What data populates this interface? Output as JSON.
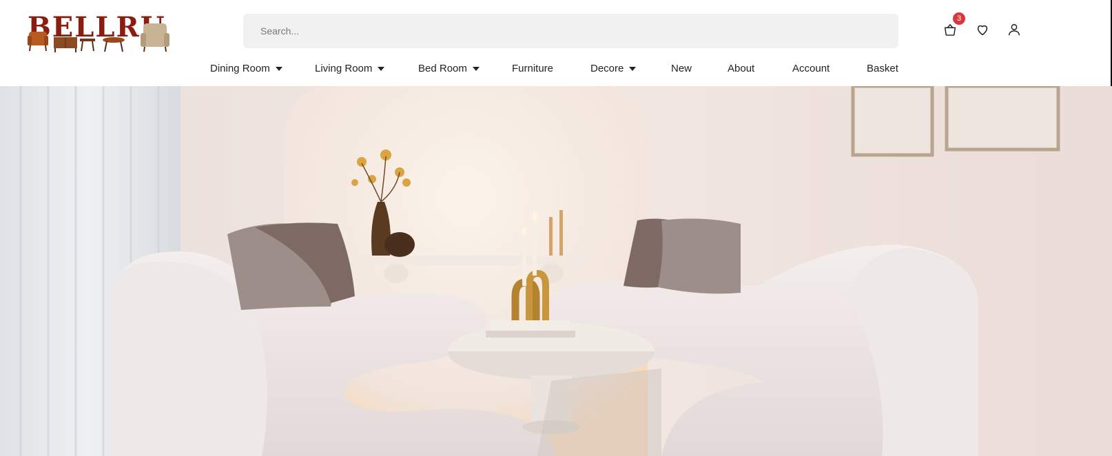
{
  "brand": {
    "logo_text": "BELLRU"
  },
  "search": {
    "placeholder": "Search..."
  },
  "header_icons": {
    "cart_icon": "shopping-basket-icon",
    "cart_count": "3",
    "wishlist_icon": "heart-icon",
    "account_icon": "user-icon"
  },
  "nav": {
    "items": [
      {
        "label": "Dining Room",
        "has_dropdown": true
      },
      {
        "label": "Living Room",
        "has_dropdown": true
      },
      {
        "label": "Bed Room",
        "has_dropdown": true
      },
      {
        "label": "Furniture",
        "has_dropdown": false
      },
      {
        "label": "Decore",
        "has_dropdown": true
      },
      {
        "label": "New",
        "has_dropdown": false
      },
      {
        "label": "About",
        "has_dropdown": false
      },
      {
        "label": "Account",
        "has_dropdown": false
      },
      {
        "label": "Basket",
        "has_dropdown": false
      }
    ]
  },
  "hero": {
    "image": "living-room-curved-sofas-photo"
  },
  "colors": {
    "brand_red": "#8b1c10",
    "badge_red": "#d9363e",
    "search_bg": "#f1f1f1"
  }
}
